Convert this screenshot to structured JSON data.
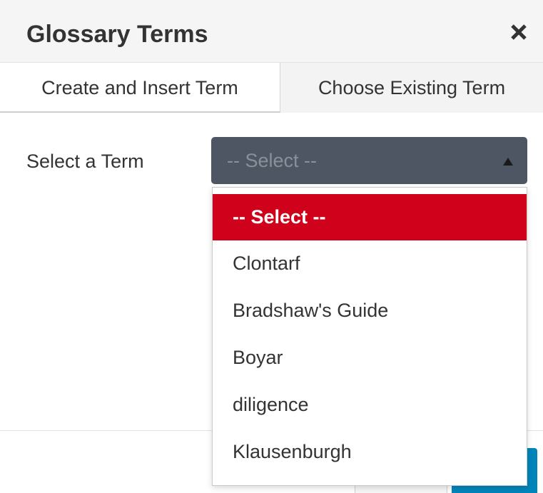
{
  "dialog": {
    "title": "Glossary Terms",
    "close_icon": "close-icon"
  },
  "tabs": [
    {
      "label": "Create and Insert Term",
      "active": true
    },
    {
      "label": "Choose Existing Term",
      "active": false
    }
  ],
  "form": {
    "label": "Select a Term",
    "select": {
      "value": "-- Select --",
      "arrow_icon": "triangle-up-icon"
    }
  },
  "dropdown": {
    "options": [
      {
        "label": "-- Select --",
        "selected": true
      },
      {
        "label": "Clontarf",
        "selected": false
      },
      {
        "label": "Bradshaw's Guide",
        "selected": false
      },
      {
        "label": "Boyar",
        "selected": false
      },
      {
        "label": "diligence",
        "selected": false
      },
      {
        "label": "Klausenburgh",
        "selected": false
      }
    ]
  },
  "colors": {
    "header_bg": "#f5f5f5",
    "select_bg": "#4f5663",
    "selected_option": "#d0021b",
    "primary_button": "#0085ba"
  }
}
